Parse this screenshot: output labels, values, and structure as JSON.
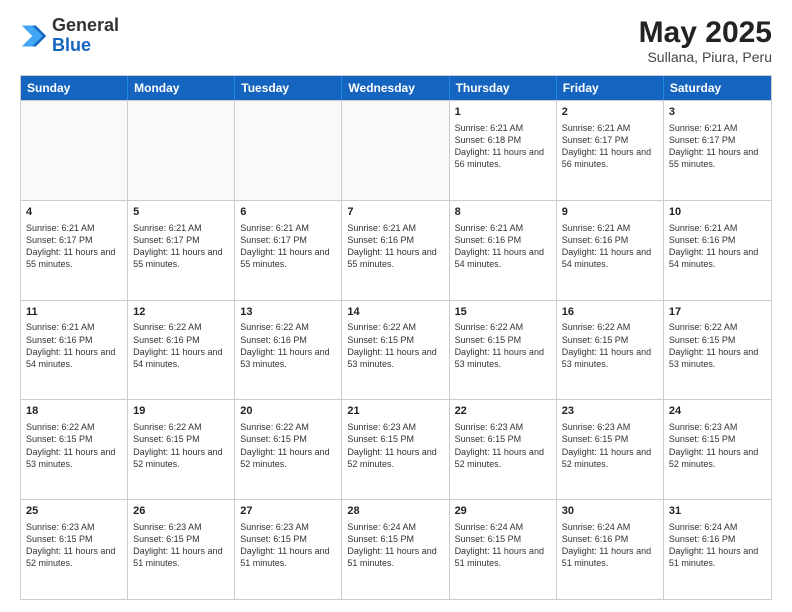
{
  "logo": {
    "general": "General",
    "blue": "Blue"
  },
  "header": {
    "month_year": "May 2025",
    "location": "Sullana, Piura, Peru"
  },
  "weekdays": [
    "Sunday",
    "Monday",
    "Tuesday",
    "Wednesday",
    "Thursday",
    "Friday",
    "Saturday"
  ],
  "rows": [
    [
      {
        "day": "",
        "empty": true
      },
      {
        "day": "",
        "empty": true
      },
      {
        "day": "",
        "empty": true
      },
      {
        "day": "",
        "empty": true
      },
      {
        "day": "1",
        "sunrise": "6:21 AM",
        "sunset": "6:18 PM",
        "daylight": "11 hours and 56 minutes."
      },
      {
        "day": "2",
        "sunrise": "6:21 AM",
        "sunset": "6:17 PM",
        "daylight": "11 hours and 56 minutes."
      },
      {
        "day": "3",
        "sunrise": "6:21 AM",
        "sunset": "6:17 PM",
        "daylight": "11 hours and 55 minutes."
      }
    ],
    [
      {
        "day": "4",
        "sunrise": "6:21 AM",
        "sunset": "6:17 PM",
        "daylight": "11 hours and 55 minutes."
      },
      {
        "day": "5",
        "sunrise": "6:21 AM",
        "sunset": "6:17 PM",
        "daylight": "11 hours and 55 minutes."
      },
      {
        "day": "6",
        "sunrise": "6:21 AM",
        "sunset": "6:17 PM",
        "daylight": "11 hours and 55 minutes."
      },
      {
        "day": "7",
        "sunrise": "6:21 AM",
        "sunset": "6:16 PM",
        "daylight": "11 hours and 55 minutes."
      },
      {
        "day": "8",
        "sunrise": "6:21 AM",
        "sunset": "6:16 PM",
        "daylight": "11 hours and 54 minutes."
      },
      {
        "day": "9",
        "sunrise": "6:21 AM",
        "sunset": "6:16 PM",
        "daylight": "11 hours and 54 minutes."
      },
      {
        "day": "10",
        "sunrise": "6:21 AM",
        "sunset": "6:16 PM",
        "daylight": "11 hours and 54 minutes."
      }
    ],
    [
      {
        "day": "11",
        "sunrise": "6:21 AM",
        "sunset": "6:16 PM",
        "daylight": "11 hours and 54 minutes."
      },
      {
        "day": "12",
        "sunrise": "6:22 AM",
        "sunset": "6:16 PM",
        "daylight": "11 hours and 54 minutes."
      },
      {
        "day": "13",
        "sunrise": "6:22 AM",
        "sunset": "6:16 PM",
        "daylight": "11 hours and 53 minutes."
      },
      {
        "day": "14",
        "sunrise": "6:22 AM",
        "sunset": "6:15 PM",
        "daylight": "11 hours and 53 minutes."
      },
      {
        "day": "15",
        "sunrise": "6:22 AM",
        "sunset": "6:15 PM",
        "daylight": "11 hours and 53 minutes."
      },
      {
        "day": "16",
        "sunrise": "6:22 AM",
        "sunset": "6:15 PM",
        "daylight": "11 hours and 53 minutes."
      },
      {
        "day": "17",
        "sunrise": "6:22 AM",
        "sunset": "6:15 PM",
        "daylight": "11 hours and 53 minutes."
      }
    ],
    [
      {
        "day": "18",
        "sunrise": "6:22 AM",
        "sunset": "6:15 PM",
        "daylight": "11 hours and 53 minutes."
      },
      {
        "day": "19",
        "sunrise": "6:22 AM",
        "sunset": "6:15 PM",
        "daylight": "11 hours and 52 minutes."
      },
      {
        "day": "20",
        "sunrise": "6:22 AM",
        "sunset": "6:15 PM",
        "daylight": "11 hours and 52 minutes."
      },
      {
        "day": "21",
        "sunrise": "6:23 AM",
        "sunset": "6:15 PM",
        "daylight": "11 hours and 52 minutes."
      },
      {
        "day": "22",
        "sunrise": "6:23 AM",
        "sunset": "6:15 PM",
        "daylight": "11 hours and 52 minutes."
      },
      {
        "day": "23",
        "sunrise": "6:23 AM",
        "sunset": "6:15 PM",
        "daylight": "11 hours and 52 minutes."
      },
      {
        "day": "24",
        "sunrise": "6:23 AM",
        "sunset": "6:15 PM",
        "daylight": "11 hours and 52 minutes."
      }
    ],
    [
      {
        "day": "25",
        "sunrise": "6:23 AM",
        "sunset": "6:15 PM",
        "daylight": "11 hours and 52 minutes."
      },
      {
        "day": "26",
        "sunrise": "6:23 AM",
        "sunset": "6:15 PM",
        "daylight": "11 hours and 51 minutes."
      },
      {
        "day": "27",
        "sunrise": "6:23 AM",
        "sunset": "6:15 PM",
        "daylight": "11 hours and 51 minutes."
      },
      {
        "day": "28",
        "sunrise": "6:24 AM",
        "sunset": "6:15 PM",
        "daylight": "11 hours and 51 minutes."
      },
      {
        "day": "29",
        "sunrise": "6:24 AM",
        "sunset": "6:15 PM",
        "daylight": "11 hours and 51 minutes."
      },
      {
        "day": "30",
        "sunrise": "6:24 AM",
        "sunset": "6:16 PM",
        "daylight": "11 hours and 51 minutes."
      },
      {
        "day": "31",
        "sunrise": "6:24 AM",
        "sunset": "6:16 PM",
        "daylight": "11 hours and 51 minutes."
      }
    ]
  ]
}
